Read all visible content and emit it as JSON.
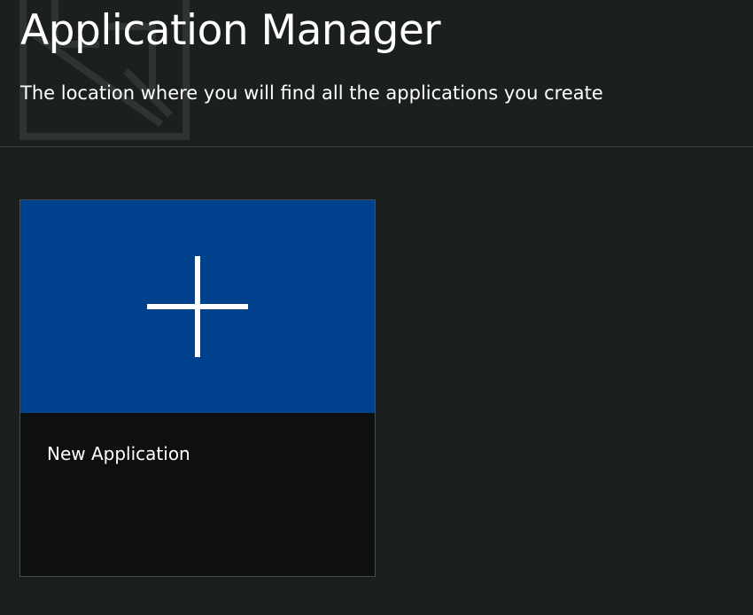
{
  "header": {
    "title": "Application Manager",
    "subtitle": "The location where you will find all the applications you create",
    "watermark_icon": "app-logo-watermark-icon"
  },
  "tiles": [
    {
      "label": "New Application",
      "icon": "plus-icon",
      "banner_color": "#00418d",
      "body_color": "#0e0f11"
    }
  ],
  "colors": {
    "background": "#1c1f20",
    "accent": "#00418d",
    "text": "#ffffff",
    "divider": "#3a3d3f"
  }
}
